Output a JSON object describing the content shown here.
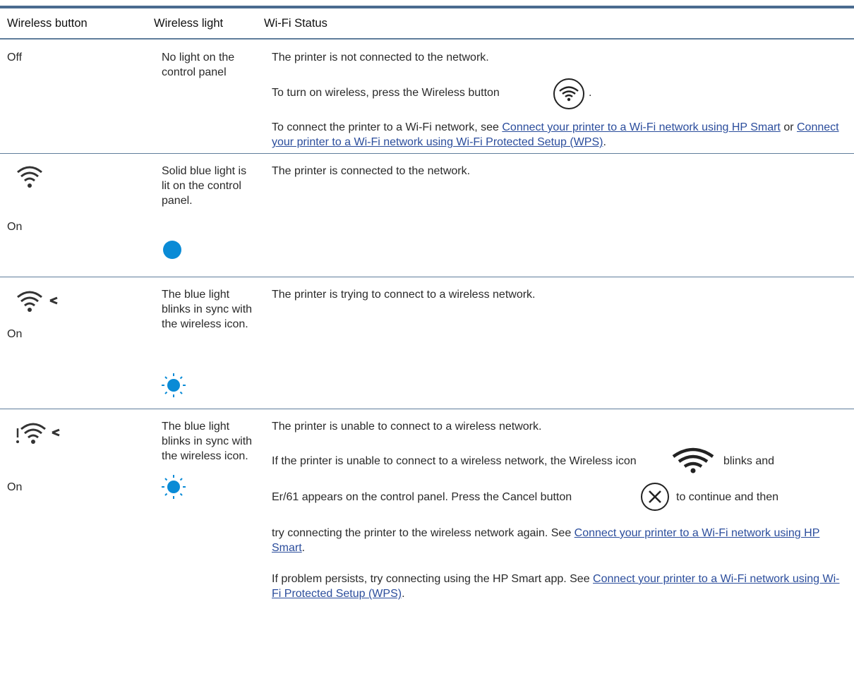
{
  "table": {
    "headers": [
      "Wireless button",
      "Wireless light",
      "Wi-Fi Status"
    ]
  },
  "rows": [
    {
      "button": "Off",
      "light": "No light on the control panel",
      "status_1": "The printer is not connected to the network.",
      "status_2_pre": "To turn on wireless, press the Wireless button",
      "status_2_post": ".",
      "status_3_pre": "To connect the printer to a Wi-Fi network, see ",
      "status_3_link1": "Connect your printer to a Wi-Fi network using HP Smart",
      "status_3_mid": " or ",
      "status_3_link2": "Connect your printer to a Wi-Fi network using Wi-Fi Protected Setup (WPS)",
      "status_3_post": "."
    },
    {
      "button": "On",
      "light": "Solid blue light is lit on the control panel.",
      "status_1": "The printer is connected to the network."
    },
    {
      "button": "On",
      "light": "The blue light blinks in sync with the wireless icon.",
      "status_1": "The printer is trying to connect to a wireless network."
    },
    {
      "button": "On",
      "light": "The blue light blinks in sync with the wireless icon.",
      "status_1": "The printer is unable to connect to a wireless network.",
      "status_2_pre": "If the printer is unable to connect to a wireless network, the Wireless icon",
      "status_2_post": "blinks and",
      "status_3_pre": "Er/61 appears on the control panel. Press the Cancel button",
      "status_3_post": "to continue and then",
      "status_4_pre": "try connecting the printer to the wireless network again. See ",
      "status_4_link": "Connect your printer to a Wi-Fi network using HP Smart",
      "status_4_post": ".",
      "status_5_pre": "If problem persists, try connecting using the HP Smart app. See ",
      "status_5_link": "Connect your printer to a Wi-Fi network using Wi-Fi Protected Setup (WPS)",
      "status_5_post": "."
    }
  ],
  "colors": {
    "rule": "#4a6b8f",
    "link": "#2b4d9c",
    "light_blue": "#0a8bd6"
  },
  "icons": {
    "wireless_button": "wifi-button-icon",
    "wifi": "wifi-icon",
    "wifi_blinking": "wifi-blinking-icon",
    "wifi_error": "wifi-error-icon",
    "blue_light": "blue-light-icon",
    "blue_light_blinking": "blinking-light-icon",
    "cancel_button": "cancel-button-icon"
  }
}
